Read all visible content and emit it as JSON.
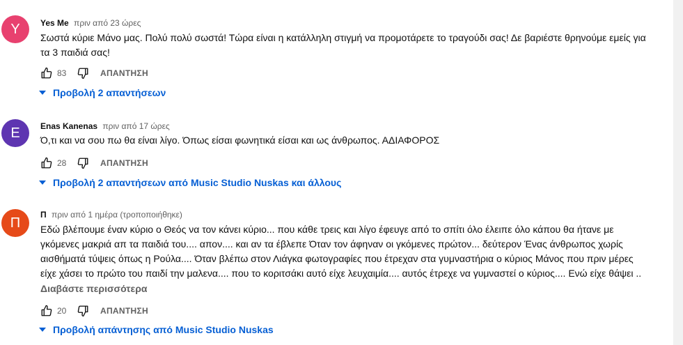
{
  "comments": [
    {
      "avatar_letter": "Y",
      "avatar_color": "#e8416f",
      "author": "Yes Me",
      "time": "πριν από 23 ώρες",
      "lines": [
        "Σωστά κύριε Μάνο μας. Πολύ πολύ σωστά! Τώρα είναι η κατάλληλη στιγμή να προμοτάρετε το τραγούδι σας! Δε βαριέστε θρηνούμε εμείς για",
        "τα 3 παιδιά σας!"
      ],
      "likes": "83",
      "reply_label": "ΑΠΑΝΤΗΣΗ",
      "replies_label": "Προβολή 2 απαντήσεων"
    },
    {
      "avatar_letter": "E",
      "avatar_color": "#5e35b1",
      "author": "Enas Kanenas",
      "time": "πριν από 17 ώρες",
      "lines": [
        "Ό,τι και να σου πω θα είναι λίγο. Όπως είσαι φωνητικά είσαι και ως άνθρωπος. ΑΔΙΑΦΟΡΟΣ"
      ],
      "likes": "28",
      "reply_label": "ΑΠΑΝΤΗΣΗ",
      "replies_label": "Προβολή 2 απαντήσεων από Music Studio Nuskas και άλλους"
    },
    {
      "avatar_letter": "Π",
      "avatar_color": "#e64a19",
      "author": "Π",
      "time": "πριν από 1 ημέρα (τροποποιήθηκε)",
      "lines": [
        "Εδώ  βλέπουμε έναν κύριο ο Θεός να τον κάνει κύριο... που κάθε τρεις και λίγο έφευγε από το σπίτι όλο έλειπε όλο κάπου θα ήτανε με",
        "γκόμενες μακριά απ τα παιδιά του.... απον.... και αν τα έβλεπε Όταν τον άφηναν οι γκόμενες πρώτον... δεύτερον Ένας άνθρωπος χωρίς",
        "αισθήματά τύψεις όπως η Ρούλα.... Όταν βλέπω στον Λιάγκα φωτογραφίες που έτρεχαν στα γυμναστήρια ο κύριος Μάνος που πριν μέρες",
        "είχε χάσει το πρώτο του παιδί την μαλενα.... που το κοριτσάκι αυτό είχε λευχαιμία.... αυτός έτρεχε να γυμναστεί ο κύριος.... Ενώ είχε θάψει .."
      ],
      "read_more": "Διαβάστε περισσότερα",
      "likes": "20",
      "reply_label": "ΑΠΑΝΤΗΣΗ",
      "replies_label": "Προβολή απάντησης από Music Studio Nuskas"
    }
  ]
}
